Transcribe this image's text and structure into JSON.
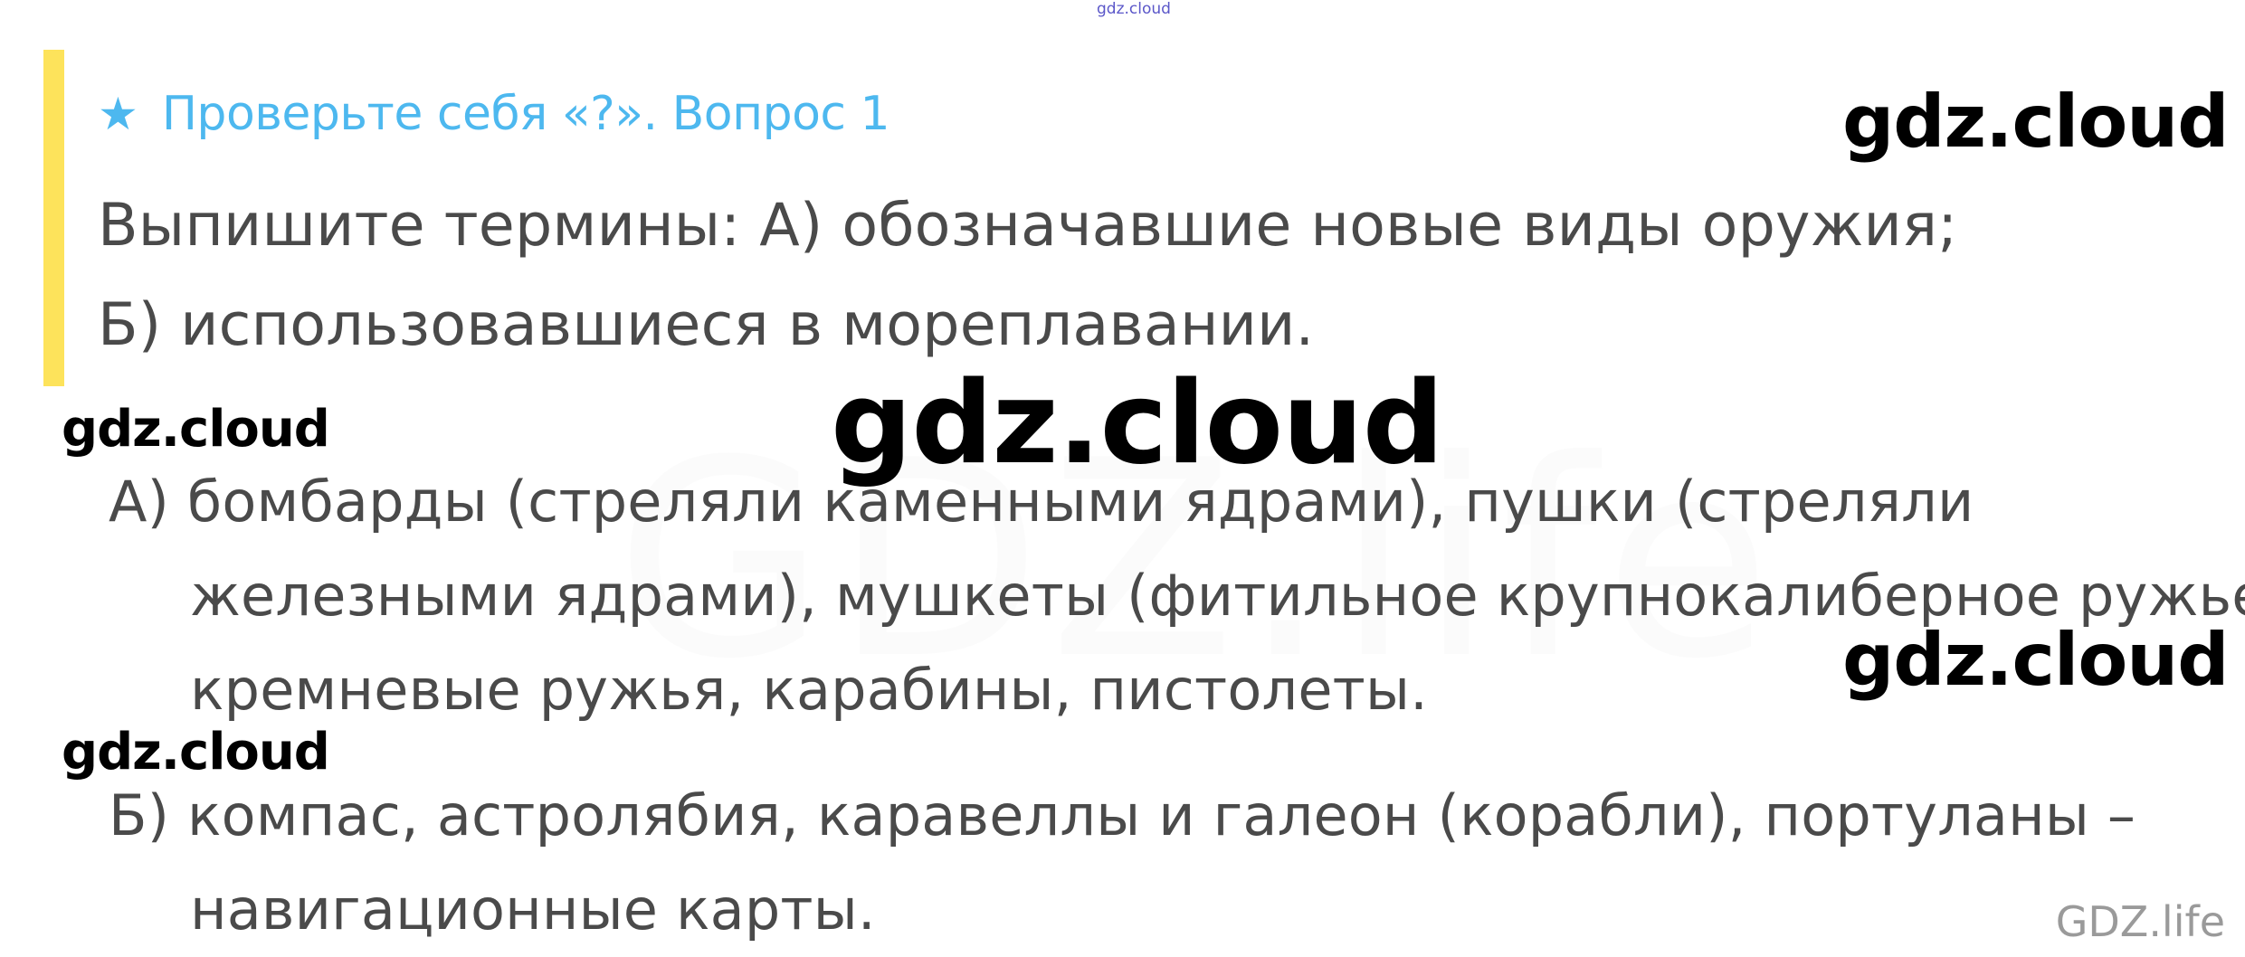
{
  "header": {
    "top_mark": "gdz.cloud"
  },
  "question": {
    "icon": "star-icon",
    "icon_glyph": "★",
    "accent_color": "#fde35b",
    "title_color": "#4db8ef",
    "title": "Проверьте себя «?». Вопрос 1",
    "lines": [
      "Выпишите термины: А) обозначавшие новые виды оружия;",
      "Б) использовавшиеся в мореплавании."
    ]
  },
  "answer": {
    "part_a": [
      "А) бомбарды (стреляли каменными ядрами), пушки (стреляли",
      "железными ядрами), мушкеты (фитильное крупнокалиберное ружье),",
      "кремневые ружья, карабины, пистолеты."
    ],
    "part_b": [
      "Б) компас, астролябия, каравеллы и галеон (корабли), портуланы –",
      "навигационные карты."
    ]
  },
  "watermarks": {
    "big": "gdz.cloud",
    "right_top": "gdz.cloud",
    "right_mid": "gdz.cloud",
    "left_1": "gdz.cloud",
    "left_2": "gdz.cloud",
    "faint": "GDZ.life"
  },
  "footer": {
    "mark": "GDZ.life"
  }
}
